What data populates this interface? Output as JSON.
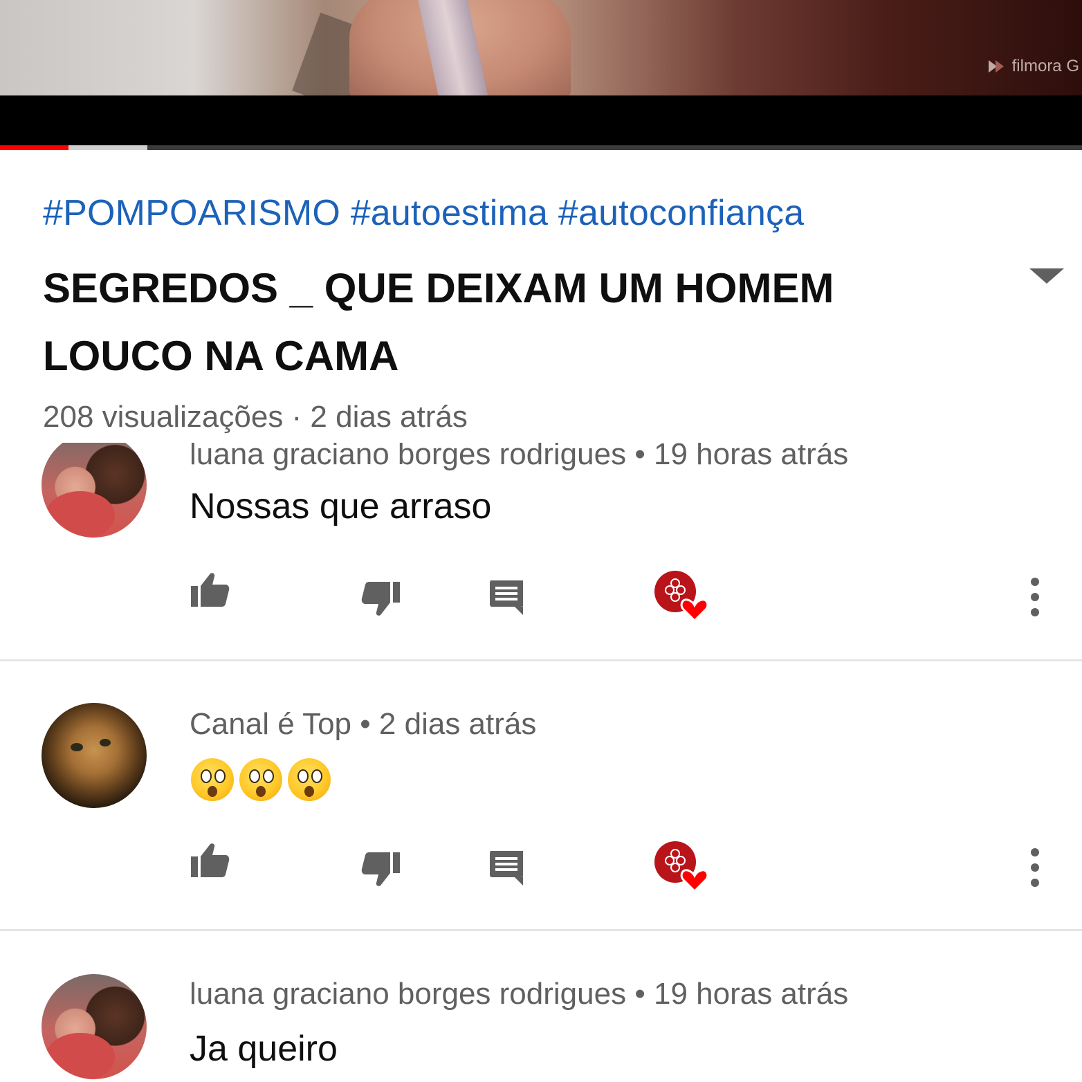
{
  "video": {
    "watermark": "filmora G",
    "progress_fraction": 0.063,
    "buffer_fraction": 0.136
  },
  "info": {
    "hashtags": [
      "#POMPOARISMO",
      "#autoestima",
      "#autoconfiança"
    ],
    "title": "SEGREDOS _ QUE DEIXAM UM HOMEM LOUCO NA CAMA",
    "meta": "208 visualizações · 2 dias atrás"
  },
  "comments": [
    {
      "author": "luana graciano borges rodrigues",
      "time": "19 horas atrás",
      "text": "Nossas que arraso",
      "avatar": "people-avatar"
    },
    {
      "author": "Canal é Top",
      "time": "2 dias atrás",
      "text": "",
      "emoji_count": 3,
      "emoji": "hushed-face-emoji",
      "avatar": "cat-avatar"
    },
    {
      "author": "luana graciano borges rodrigues",
      "time": "19 horas atrás",
      "text": "Ja queiro",
      "avatar": "people-avatar"
    }
  ],
  "icons": {
    "like": "thumbs-up-icon",
    "dislike": "thumbs-down-icon",
    "reply": "reply-icon",
    "creator_heart": "creator-heart-icon",
    "more": "more-vertical-icon"
  },
  "colors": {
    "accent_red": "#ff0000",
    "hashtag_blue": "#1c62b9",
    "secondary_text": "#606060",
    "heart_red": "#ff0000"
  }
}
